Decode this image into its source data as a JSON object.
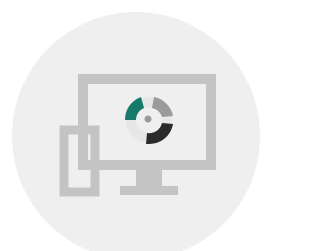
{
  "icon": {
    "name": "multi-device-analytics-icon",
    "parts": [
      "monitor-icon",
      "phone-icon",
      "donut-chart-icon"
    ]
  },
  "colors": {
    "circle_background": "#efefef",
    "device_outline": "#c4c4c4",
    "chart_teal": "#167a6b",
    "chart_dark": "#2b2b2b",
    "chart_gray": "#9a9a9a",
    "chart_track": "#e7e7e7"
  }
}
